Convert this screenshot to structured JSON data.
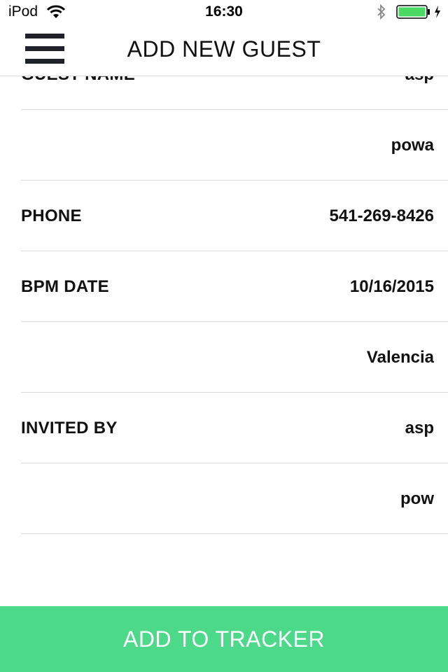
{
  "status_bar": {
    "carrier": "iPod",
    "time": "16:30",
    "battery_color": "#4cd964"
  },
  "nav": {
    "title": "ADD NEW GUEST"
  },
  "form": {
    "rows": [
      {
        "label": "GUEST NAME",
        "value": "asp"
      },
      {
        "label": "",
        "value": "powa"
      },
      {
        "label": "PHONE",
        "value": "541-269-8426"
      },
      {
        "label": "BPM DATE",
        "value": "10/16/2015"
      },
      {
        "label": "",
        "value": "Valencia"
      },
      {
        "label": "INVITED BY",
        "value": "asp"
      },
      {
        "label": "",
        "value": "pow"
      }
    ]
  },
  "footer": {
    "button_label": "ADD TO TRACKER",
    "button_color": "#4cd98a"
  }
}
